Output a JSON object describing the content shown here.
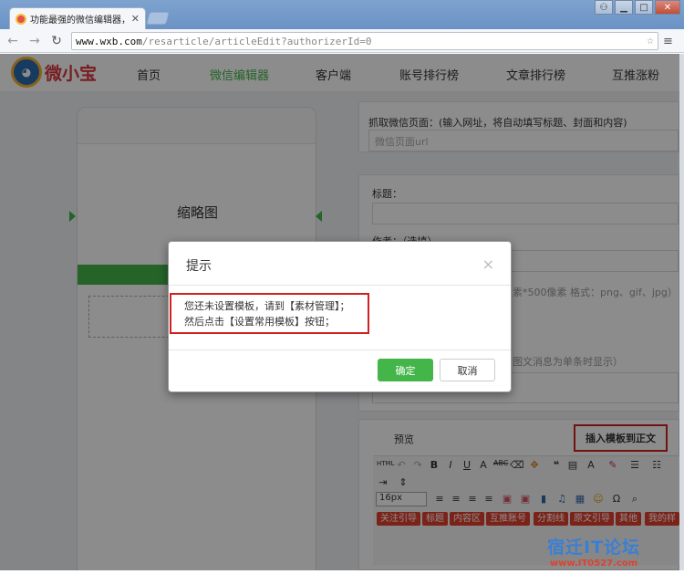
{
  "browser": {
    "tab_title": "功能最强的微信编辑器，",
    "url_host": "www.wxb.com",
    "url_path": "/resarticle/articleEdit?authorizerId=0",
    "window_controls": [
      "user-icon",
      "minimize-icon",
      "maximize-icon",
      "close-icon"
    ]
  },
  "site": {
    "logo_text": "微小宝",
    "nav": [
      "首页",
      "微信编辑器",
      "客户端",
      "账号排行榜",
      "文章排行榜",
      "互推涨粉"
    ],
    "active_nav": "微信编辑器"
  },
  "editor": {
    "thumbnail_label": "缩略图",
    "fetch_label": "抓取微信页面：(输入网址，将自动填写标题、封面和内容)",
    "fetch_placeholder": "微信页面url",
    "title_label": "标题：",
    "author_label": "作者：（选填）",
    "cover_hint": "素*500像素 格式：png、gif、jpg）",
    "summary_hint": "图文消息为单条时显示）",
    "preview_label": "预览",
    "insert_template_button": "插入模板到正文",
    "font_size": "16px",
    "template_tags": [
      "关注引导",
      "标题",
      "内容区",
      "互推账号",
      "分割线",
      "原文引导",
      "其他",
      "我的样"
    ]
  },
  "dialog": {
    "title": "提示",
    "close": "×",
    "line1": "您还未设置模板，请到【素材管理】；",
    "line2": "然后点击【设置常用模板】按钮；",
    "ok": "确定",
    "cancel": "取消"
  },
  "watermark": {
    "text": "宿迁IT论坛",
    "url": "www.IT0527.com"
  },
  "colors": {
    "accent_green": "#44b549",
    "highlight_red": "#d21f1f",
    "tag_red": "#e0412f"
  }
}
